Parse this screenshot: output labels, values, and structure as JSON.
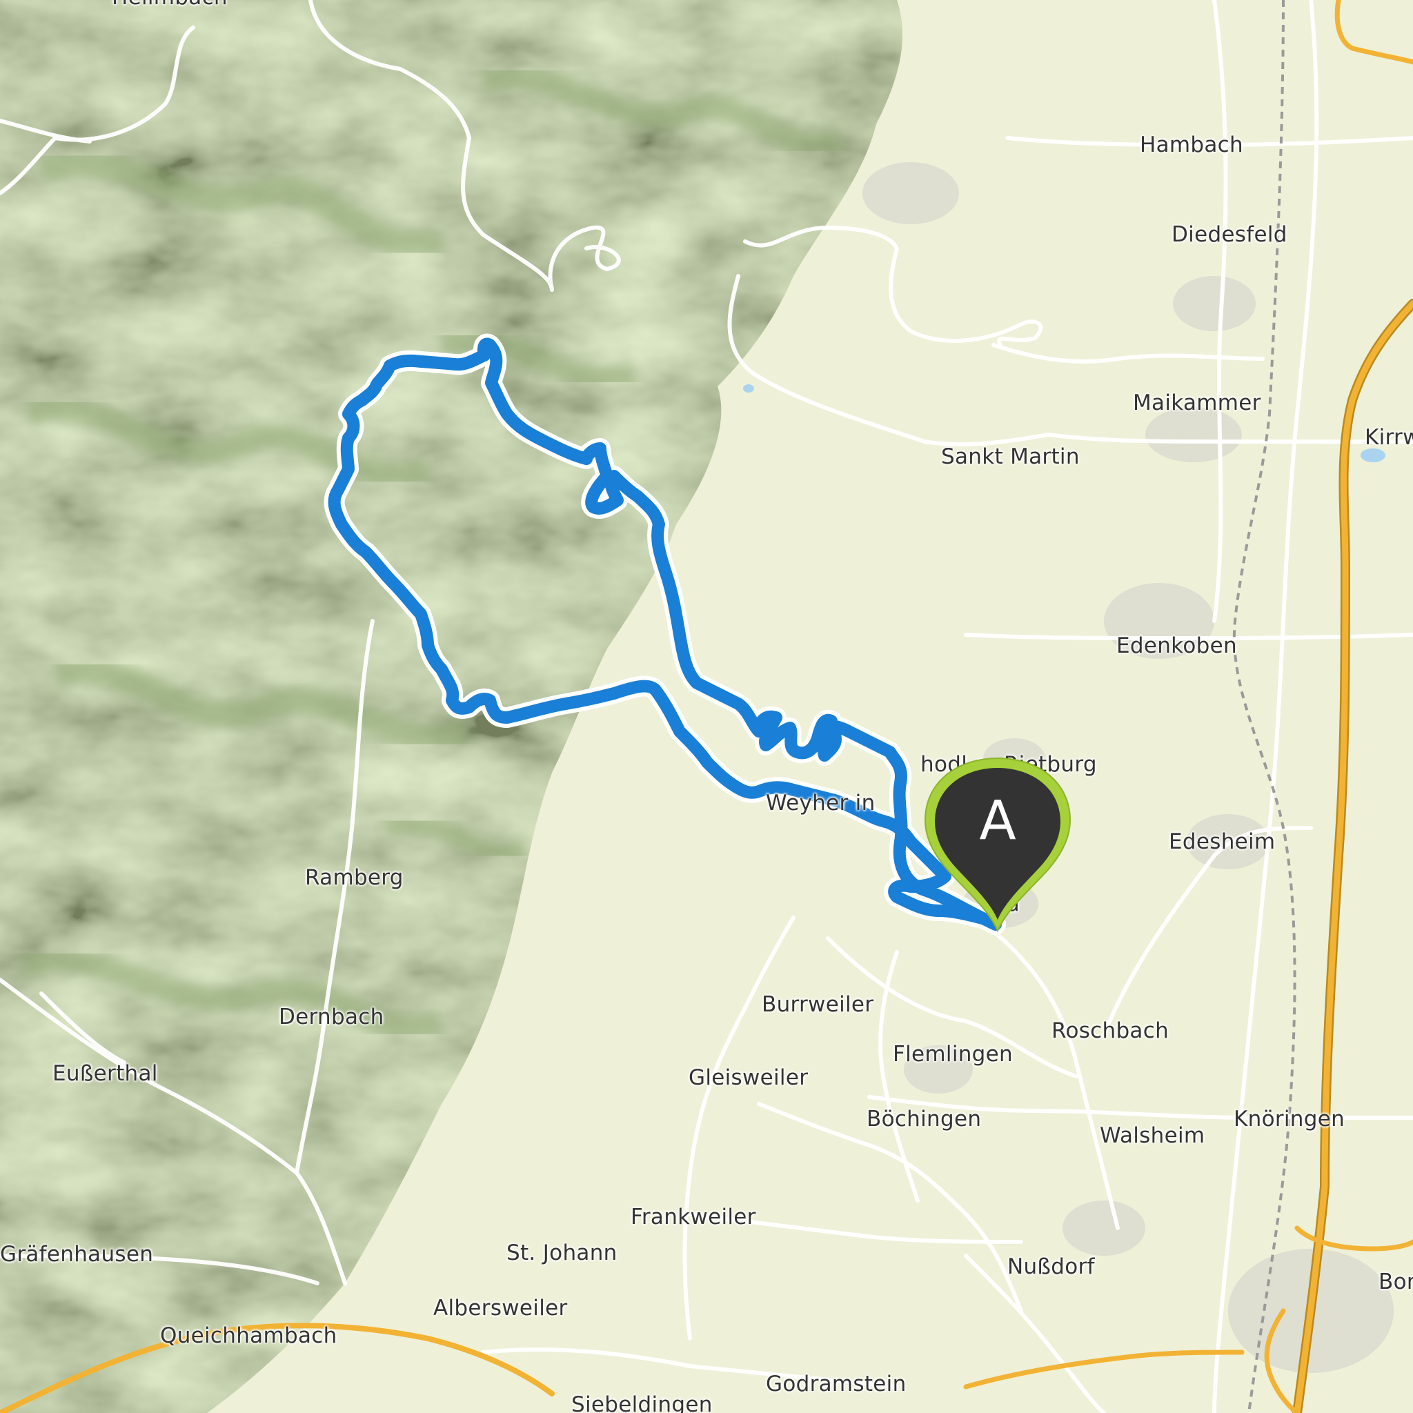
{
  "map": {
    "places": [
      {
        "id": "hambach",
        "name": "Hambach"
      },
      {
        "id": "diedesfeld",
        "name": "Diedesfeld"
      },
      {
        "id": "maikammer",
        "name": "Maikammer"
      },
      {
        "id": "kirrweiler",
        "name": "Kirrw"
      },
      {
        "id": "sankt-martin",
        "name": "Sankt Martin"
      },
      {
        "id": "edenkoben",
        "name": "Edenkoben"
      },
      {
        "id": "rietburg",
        "name": "hodl   er Rietburg"
      },
      {
        "id": "weyher",
        "name": "Weyher in"
      },
      {
        "id": "edesheim",
        "name": "Edesheim"
      },
      {
        "id": "rhodt",
        "name": "nd"
      },
      {
        "id": "ramberg",
        "name": "Ramberg"
      },
      {
        "id": "burrweiler",
        "name": "Burrweiler"
      },
      {
        "id": "roschbach",
        "name": "Roschbach"
      },
      {
        "id": "flemlingen",
        "name": "Flemlingen"
      },
      {
        "id": "dernbach",
        "name": "Dernbach"
      },
      {
        "id": "gleisweiler",
        "name": "Gleisweiler"
      },
      {
        "id": "eusserthal",
        "name": "Eußerthal"
      },
      {
        "id": "boechingen",
        "name": "Böchingen"
      },
      {
        "id": "walsheim",
        "name": "Walsheim"
      },
      {
        "id": "knoeringen",
        "name": "Knöringen"
      },
      {
        "id": "frankweiler",
        "name": "Frankweiler"
      },
      {
        "id": "st-johann",
        "name": "St. Johann"
      },
      {
        "id": "nussdorf",
        "name": "Nußdorf"
      },
      {
        "id": "graefenhausen",
        "name": "Gräfenhausen"
      },
      {
        "id": "albersweiler",
        "name": "Albersweiler"
      },
      {
        "id": "bornheim",
        "name": "Bor"
      },
      {
        "id": "queichhambach",
        "name": "Queichhambach"
      },
      {
        "id": "godramstein",
        "name": "Godramstein"
      },
      {
        "id": "siebeldingen",
        "name": "Siebeldingen"
      },
      {
        "id": "hellmbach",
        "name": "Hellmbach"
      }
    ],
    "start_marker": {
      "label": "A"
    },
    "colors": {
      "route": "#1a7fd6",
      "marker_fill": "#333333",
      "marker_border": "#a6d13a",
      "forest": "#c7dba0",
      "lowland": "#eef0d8",
      "motorway": "#f2b233"
    }
  }
}
